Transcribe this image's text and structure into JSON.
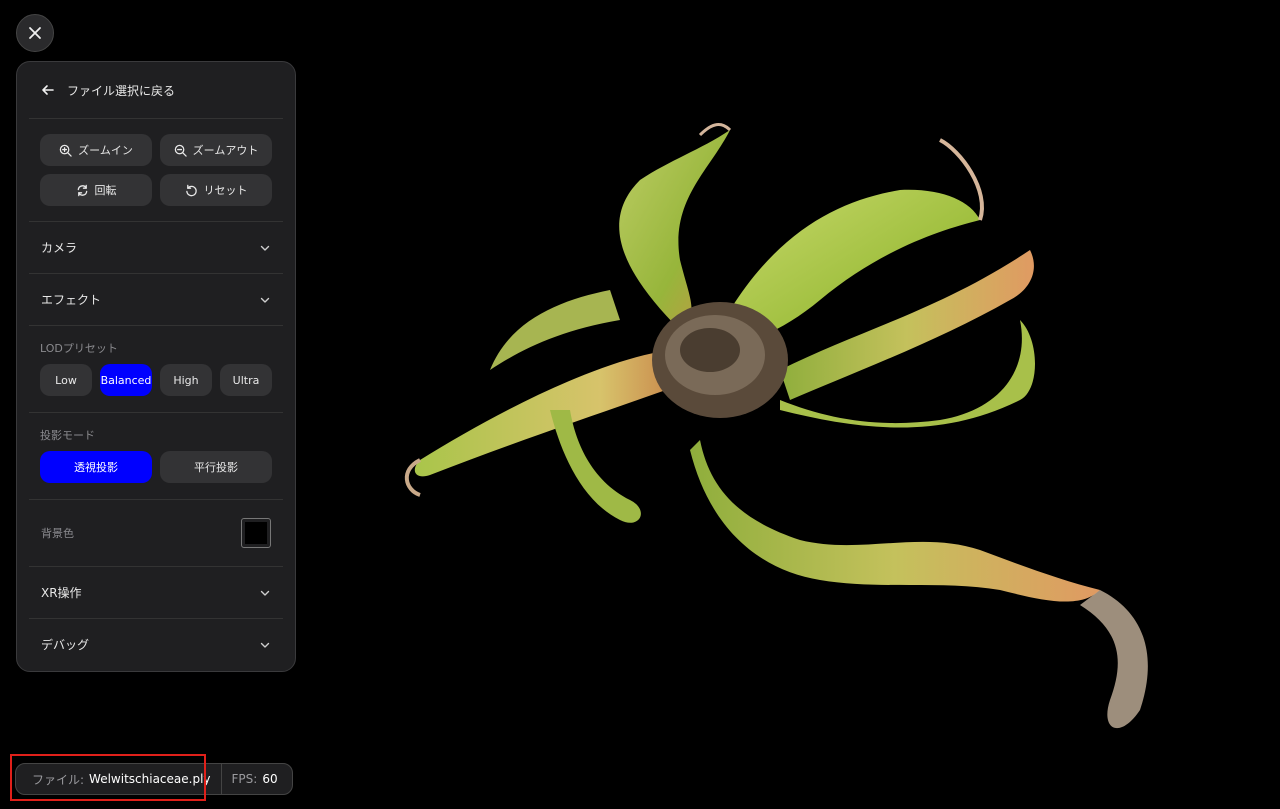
{
  "panel": {
    "back_label": "ファイル選択に戻る",
    "tools": {
      "zoom_in": "ズームイン",
      "zoom_out": "ズームアウト",
      "rotate": "回転",
      "reset": "リセット"
    },
    "sections": {
      "camera": "カメラ",
      "effects": "エフェクト",
      "xr": "XR操作",
      "debug": "デバッグ"
    },
    "lod": {
      "label": "LODプリセット",
      "options": [
        "Low",
        "Balanced",
        "High",
        "Ultra"
      ],
      "selected": "Balanced"
    },
    "projection": {
      "label": "投影モード",
      "options": [
        "透視投影",
        "平行投影"
      ],
      "selected": "透視投影"
    },
    "background": {
      "label": "背景色",
      "color": "#000000"
    }
  },
  "status": {
    "file_label": "ファイル:",
    "file_name": "Welwitschiaceae.ply",
    "fps_label": "FPS:",
    "fps_value": "60"
  },
  "colors": {
    "accent": "#0000ff",
    "highlight": "#e0201a"
  },
  "icons": {
    "close": "close-icon",
    "back": "arrow-left-icon",
    "zoom_in": "zoom-in-icon",
    "zoom_out": "zoom-out-icon",
    "rotate": "rotate-icon",
    "reset": "reset-icon",
    "chevron": "chevron-down-icon"
  }
}
